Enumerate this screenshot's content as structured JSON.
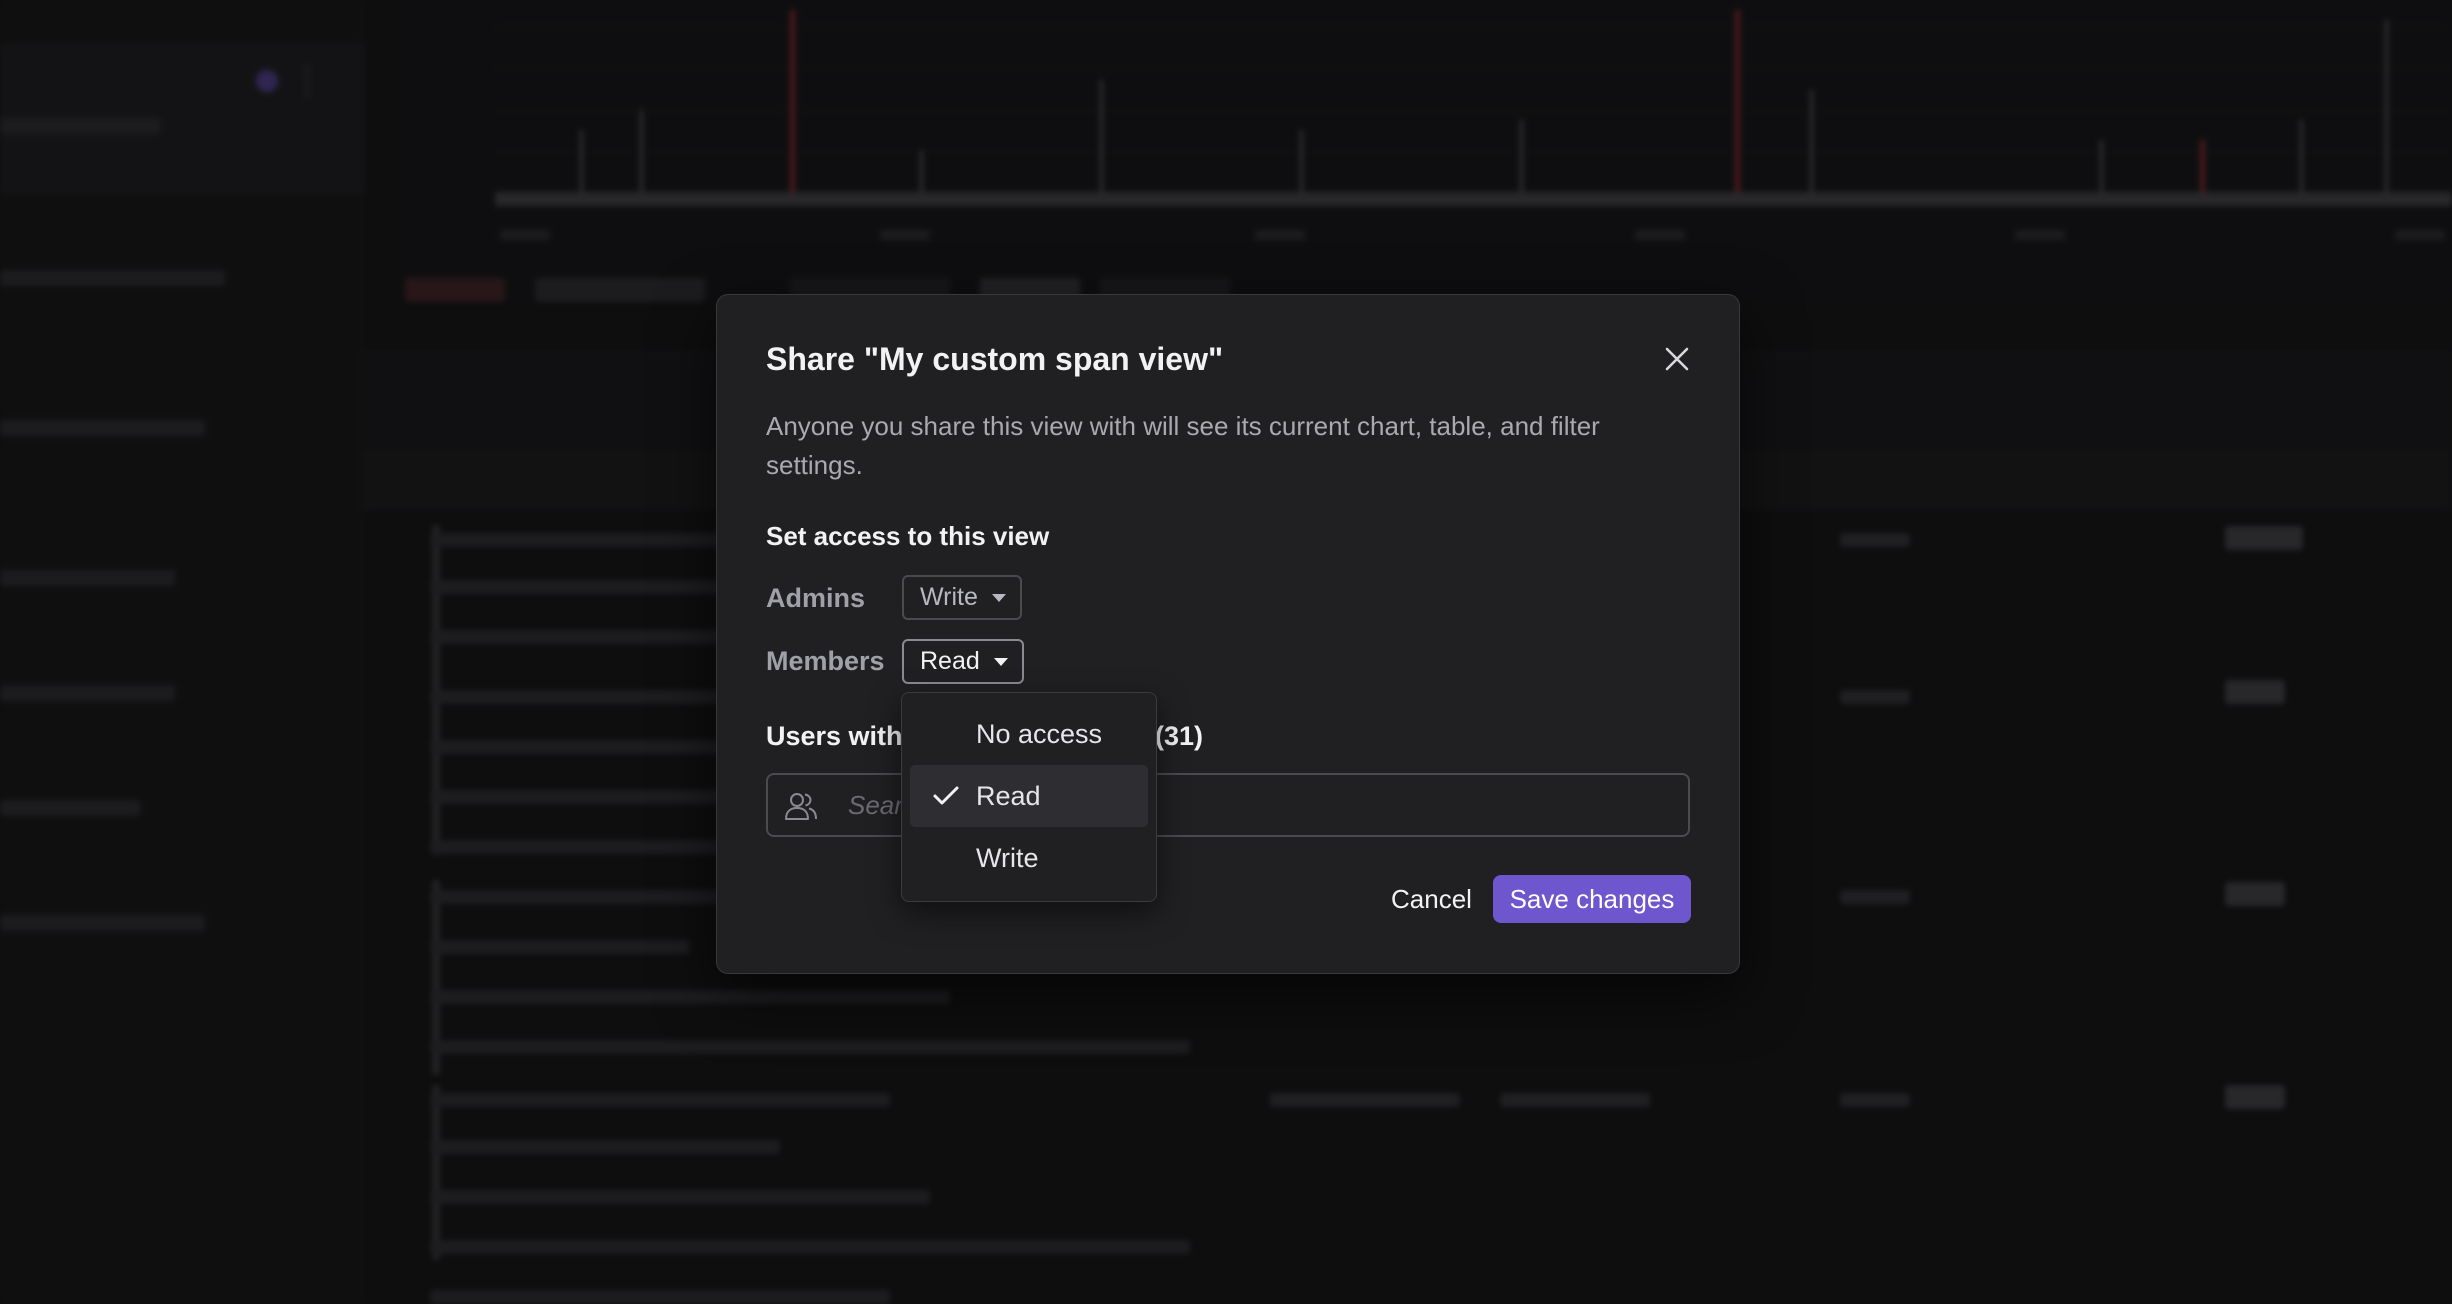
{
  "modal": {
    "title": "Share \"My custom span view\"",
    "description": "Anyone you share this view with will see its current chart, table, and filter settings.",
    "access_heading": "Set access to this view",
    "roles": [
      {
        "label": "Admins",
        "value": "Write"
      },
      {
        "label": "Members",
        "value": "Read"
      }
    ],
    "users_heading": "Users with",
    "users_count": "(31)",
    "search": {
      "placeholder": "Search",
      "value": ""
    },
    "cancel_label": "Cancel",
    "save_label": "Save changes"
  },
  "dropdown": {
    "options": [
      "No access",
      "Read",
      "Write"
    ],
    "selected": "Read"
  },
  "icons": {
    "close": "close-icon",
    "search": "users-icon",
    "checkmark": "check-icon",
    "caret": "caret-down-icon"
  },
  "colors": {
    "accent": "#6e56cf",
    "modal_bg": "#202023",
    "page_bg": "#111113",
    "error_marker": "#c0323a"
  }
}
